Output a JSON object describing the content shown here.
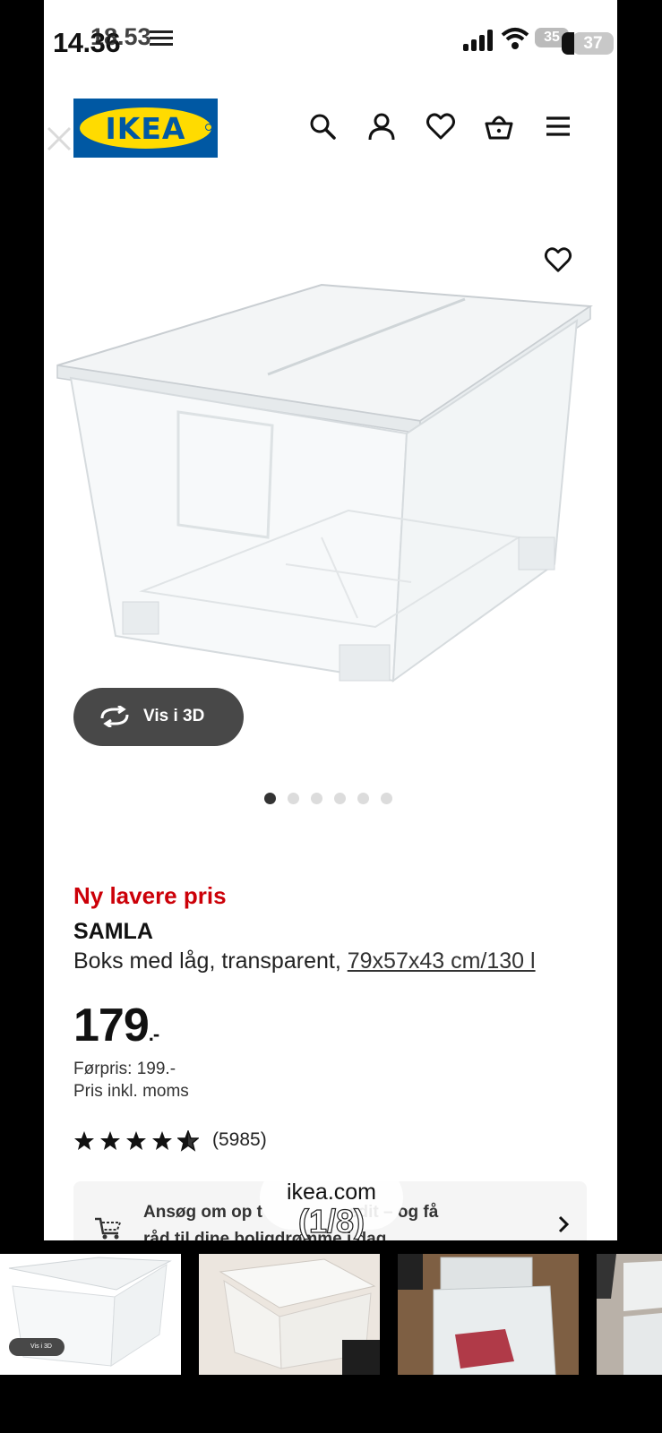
{
  "status_bar": {
    "time_primary": "14.36",
    "time_overlay": "18.53",
    "battery_a": "35",
    "battery_b": "37"
  },
  "header": {
    "logo_text": "IKEA",
    "icons": [
      "search-icon",
      "account-icon",
      "favourites-icon",
      "basket-icon",
      "menu-icon"
    ]
  },
  "gallery": {
    "view_3d_label": "Vis i 3D",
    "image_count": 6,
    "active_index": 0,
    "counter": "(1/8)"
  },
  "product": {
    "badge": "Ny lavere pris",
    "name": "SAMLA",
    "description": "Boks med låg, transparent,",
    "size_link": "79x57x43 cm/130 l",
    "price": "179",
    "price_suffix": ".-",
    "previous_price": "Førpris: 199.-",
    "vat_note": "Pris inkl. moms",
    "rating": 4.5,
    "review_count": "(5985)"
  },
  "banner": {
    "line1_left": "Ansøg om op t",
    "line1_right": "edit – og få",
    "line2": "råd til dine boligdrømme i dag"
  },
  "source": {
    "site": "ikea.com"
  },
  "thumbnails": {
    "mini_3d_label": "Vis i 3D",
    "count": 4
  },
  "colors": {
    "ikea_blue": "#0058a3",
    "ikea_yellow": "#ffdb00",
    "sale_red": "#cc0008",
    "dark_button": "#484848"
  }
}
